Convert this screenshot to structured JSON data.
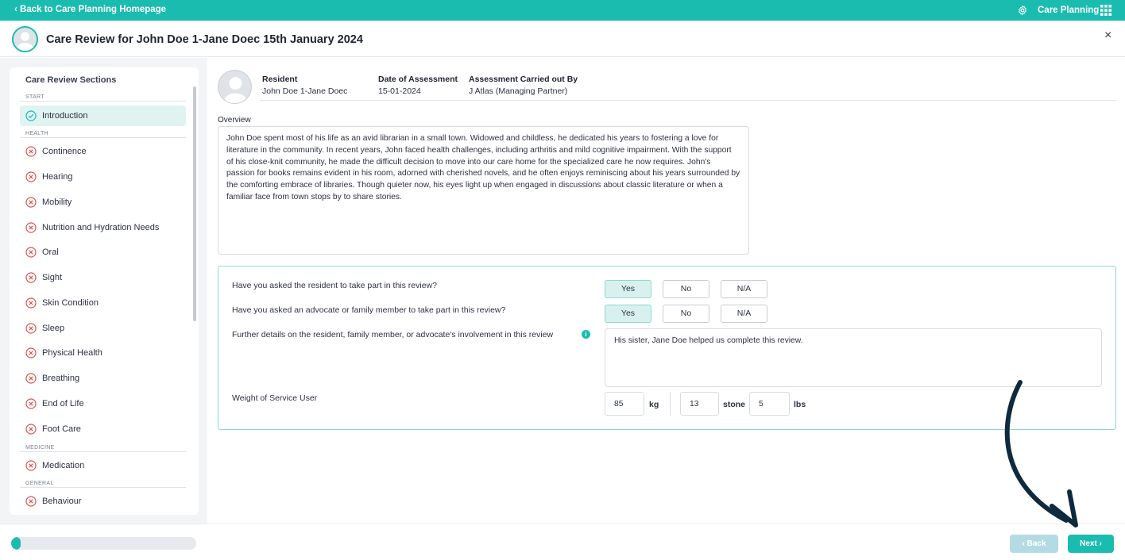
{
  "topbar": {
    "back_label": "‹ Back to Care Planning Homepage",
    "app_name": "Care Planning",
    "gear_icon": "gear-icon",
    "apps_icon": "grid-icon"
  },
  "header": {
    "title": "Care Review for John Doe 1-Jane Doec 15th January 2024",
    "close_label": "×"
  },
  "sidebar": {
    "title": "Care Review Sections",
    "groups": {
      "start": "START",
      "health": "HEALTH",
      "medicine": "MEDICINE",
      "general": "GENERAL"
    },
    "items": [
      {
        "label": "Introduction",
        "status": "complete"
      },
      {
        "label": "Continence",
        "status": "incomplete"
      },
      {
        "label": "Hearing",
        "status": "incomplete"
      },
      {
        "label": "Mobility",
        "status": "incomplete"
      },
      {
        "label": "Nutrition and Hydration Needs",
        "status": "incomplete"
      },
      {
        "label": "Oral",
        "status": "incomplete"
      },
      {
        "label": "Sight",
        "status": "incomplete"
      },
      {
        "label": "Skin Condition",
        "status": "incomplete"
      },
      {
        "label": "Sleep",
        "status": "incomplete"
      },
      {
        "label": "Physical Health",
        "status": "incomplete"
      },
      {
        "label": "Breathing",
        "status": "incomplete"
      },
      {
        "label": "End of Life",
        "status": "incomplete"
      },
      {
        "label": "Foot Care",
        "status": "incomplete"
      },
      {
        "label": "Medication",
        "status": "incomplete"
      },
      {
        "label": "Behaviour",
        "status": "incomplete"
      }
    ]
  },
  "resident": {
    "resident_label": "Resident",
    "resident_value": "John Doe 1-Jane Doec",
    "date_label": "Date of Assessment",
    "date_value": "15-01-2024",
    "assessor_label": "Assessment Carried out By",
    "assessor_value": "J Atlas (Managing Partner)"
  },
  "overview": {
    "label": "Overview",
    "text": "John Doe spent most of his life as an avid librarian in a small town. Widowed and childless, he dedicated his years to fostering a love for literature in the community. In recent years, John faced health challenges, including arthritis and mild cognitive impairment. With the support of his close-knit community, he made the difficult decision to move into our care home for the specialized care he now requires. John's passion for books remains evident in his room, adorned with cherished novels, and he often enjoys reminiscing about his years surrounded by the comforting embrace of libraries. Though quieter now, his eyes light up when engaged in discussions about classic literature or when a familiar face from town stops by to share stories."
  },
  "questions": {
    "q1": {
      "label": "Have you asked the resident to take part in this review?",
      "options": [
        "Yes",
        "No",
        "N/A"
      ],
      "selected": "Yes"
    },
    "q2": {
      "label": "Have you asked an advocate or family member to take part in this review?",
      "options": [
        "Yes",
        "No",
        "N/A"
      ],
      "selected": "Yes"
    },
    "details_label": "Further details on the resident, family member, or advocate's involvement in this review",
    "details_value": "His sister, Jane Doe helped us complete this review.",
    "info_glyph": "i",
    "weight_label": "Weight of Service User",
    "weight_kg": "85",
    "kg_unit": "kg",
    "weight_stone": "13",
    "stone_unit": "stone",
    "weight_lbs": "5",
    "lbs_unit": "lbs"
  },
  "footer": {
    "progress_fraction": 0.05,
    "back_label": "‹ Back",
    "next_label": "Next ›"
  },
  "colors": {
    "accent": "#1bbcb0",
    "error": "#d9534f",
    "annotation_arrow": "#0f2a3d"
  }
}
